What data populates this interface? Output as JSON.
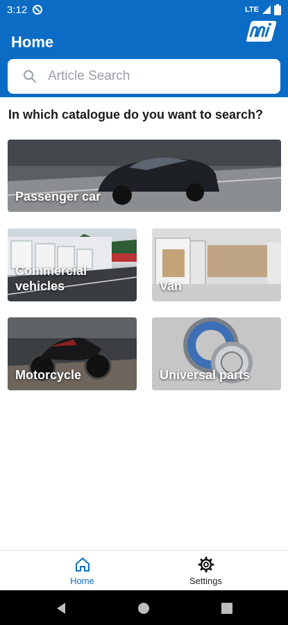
{
  "status_bar": {
    "time": "3:12",
    "network": "LTE"
  },
  "header": {
    "title": "Home"
  },
  "search": {
    "placeholder": "Article Search",
    "value": ""
  },
  "main": {
    "question": "In which catalogue do you want to search?",
    "tiles": [
      {
        "label": "Passenger car"
      },
      {
        "label": "Commercial vehicles"
      },
      {
        "label": "Van"
      },
      {
        "label": "Motorcycle"
      },
      {
        "label": "Universal parts"
      }
    ]
  },
  "bottom_nav": {
    "items": [
      {
        "label": "Home",
        "icon": "home-icon",
        "active": true
      },
      {
        "label": "Settings",
        "icon": "gear-icon",
        "active": false
      }
    ]
  },
  "colors": {
    "brand": "#0a6cc4",
    "active_nav": "#0a6cc4"
  }
}
